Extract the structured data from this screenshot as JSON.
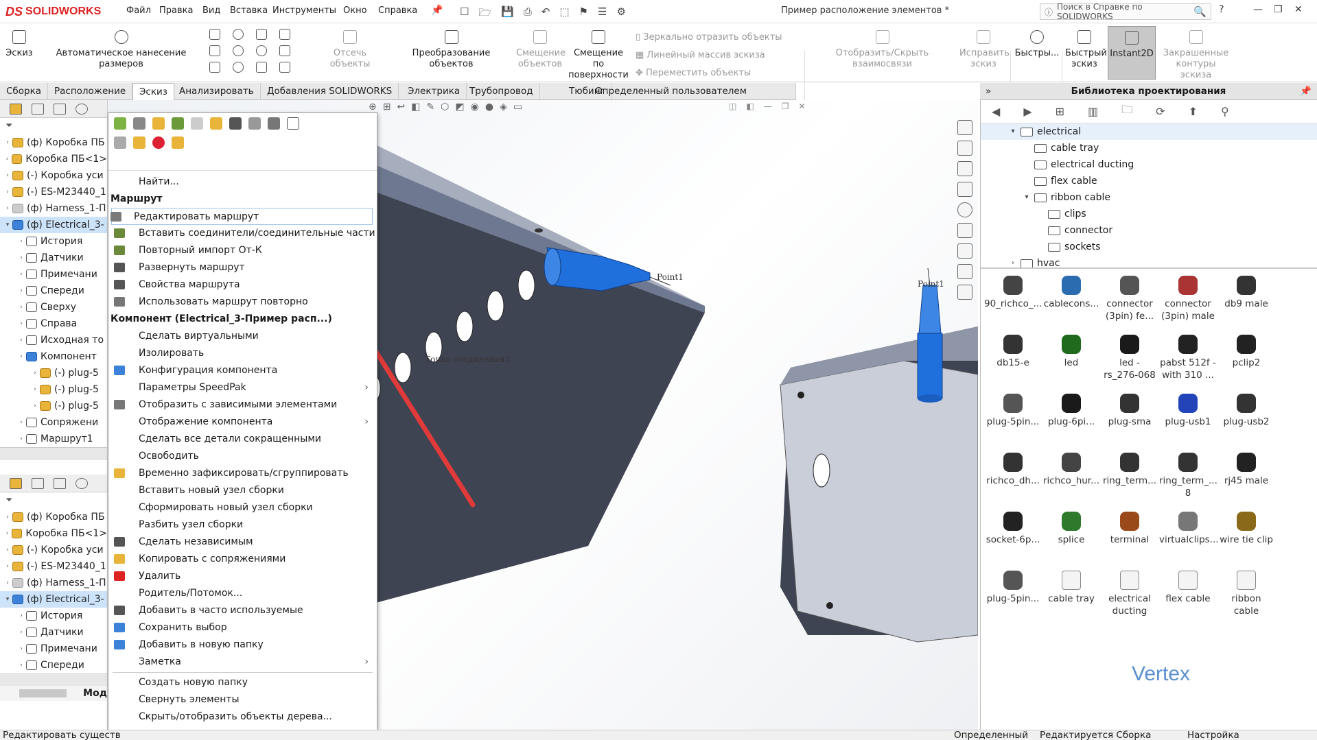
{
  "app": {
    "logo_text": "SOLIDWORKS",
    "logo_mark": "DS",
    "accent": "#d22020"
  },
  "menu": [
    "Файл",
    "Правка",
    "Вид",
    "Вставка",
    "Инструменты",
    "Окно",
    "Справка"
  ],
  "title": "Пример расположение элементов *",
  "help_search": {
    "placeholder": "Поиск в Справке по SOLIDWORKS"
  },
  "ribbon": {
    "sketch": "Эскиз",
    "auto_dim": "Автоматическое нанесение размеров",
    "trim": "Отсечь объекты",
    "convert": "Преобразование объектов",
    "offset1": "Смещение",
    "offset2": "объектов",
    "offset_surf1": "Смещение по",
    "offset_surf2": "поверхности",
    "mirror": "Зеркально отразить объекты",
    "linear": "Линейный массив эскиза",
    "move": "Переместить объекты",
    "show_hide": "Отобразить/Скрыть взаимосвязи",
    "fix1": "Исправить",
    "fix2": "эскиз",
    "quick1": "Быстры...",
    "qsketch1": "Быстрый",
    "qsketch2": "эскиз",
    "instant2d": "Instant2D",
    "shaded1": "Закрашенные",
    "shaded2": "контуры эскиза"
  },
  "tabs": [
    "Сборка",
    "Расположение",
    "Эскиз",
    "Анализировать",
    "Добавления SOLIDWORKS",
    "Электрика",
    "Трубопровод",
    "Тюбинг",
    "Определенный пользователем маршрут"
  ],
  "tree_top": [
    {
      "label": "(ф) Коробка ПБ",
      "type": "asm"
    },
    {
      "label": "Коробка ПБ<1>",
      "type": "asm"
    },
    {
      "label": "(-) Коробка уси",
      "type": "asm"
    },
    {
      "label": "(-) ES-M23440_1",
      "type": "asm"
    },
    {
      "label": "(ф) Harness_1-П",
      "type": "grey"
    },
    {
      "label": "(ф) Electrical_3-",
      "type": "blue",
      "sel": true
    },
    {
      "label": "История",
      "type": "folder",
      "indent": 1
    },
    {
      "label": "Датчики",
      "type": "folder",
      "indent": 1
    },
    {
      "label": "Примечани",
      "type": "folder",
      "indent": 1
    },
    {
      "label": "Спереди",
      "type": "folder",
      "indent": 1
    },
    {
      "label": "Сверху",
      "type": "folder",
      "indent": 1
    },
    {
      "label": "Справа",
      "type": "folder",
      "indent": 1
    },
    {
      "label": "Исходная то",
      "type": "folder",
      "indent": 1
    },
    {
      "label": "Компонент",
      "type": "blue",
      "indent": 1
    },
    {
      "label": "(-) plug-5",
      "type": "asm",
      "indent": 2
    },
    {
      "label": "(-) plug-5",
      "type": "asm",
      "indent": 2
    },
    {
      "label": "(-) plug-5",
      "type": "asm",
      "indent": 2
    },
    {
      "label": "Сопряжени",
      "type": "folder",
      "indent": 1
    },
    {
      "label": "Маршрут1",
      "type": "folder",
      "indent": 1
    }
  ],
  "tree_bottom": [
    {
      "label": "(ф) Коробка ПБ",
      "type": "asm"
    },
    {
      "label": "Коробка ПБ<1>",
      "type": "asm"
    },
    {
      "label": "(-) Коробка уси",
      "type": "asm"
    },
    {
      "label": "(-) ES-M23440_1",
      "type": "asm"
    },
    {
      "label": "(ф) Harness_1-П",
      "type": "grey"
    },
    {
      "label": "(ф) Electrical_3-",
      "type": "blue",
      "sel": true
    },
    {
      "label": "История",
      "type": "folder",
      "indent": 1
    },
    {
      "label": "Датчики",
      "type": "folder",
      "indent": 1
    },
    {
      "label": "Примечани",
      "type": "folder",
      "indent": 1
    },
    {
      "label": "Спереди",
      "type": "folder",
      "indent": 1
    }
  ],
  "left_bottom_tab": "Мод",
  "context_menu": {
    "find": "Найти...",
    "route_header": "Маршрут",
    "route_items": [
      {
        "label": "Редактировать маршрут",
        "hl": true,
        "color": "#7a7a7a"
      },
      {
        "label": "Вставить соединители/соединительные части",
        "color": "#6a8a3a"
      },
      {
        "label": "Повторный импорт От-К",
        "color": "#6a8a3a"
      },
      {
        "label": "Развернуть маршрут",
        "color": "#555"
      },
      {
        "label": "Свойства маршрута",
        "color": "#555"
      },
      {
        "label": "Использовать маршрут повторно",
        "color": "#777"
      }
    ],
    "component_header": "Компонент (Electrical_3-Пример расп...)",
    "component_items": [
      {
        "label": "Сделать виртуальными"
      },
      {
        "label": "Изолировать"
      },
      {
        "label": "Конфигурация компонента",
        "color": "#3b82d8"
      },
      {
        "label": "Параметры SpeedPak",
        "sub": true
      },
      {
        "label": "Отобразить с зависимыми элементами",
        "color": "#777"
      },
      {
        "label": "Отображение компонента",
        "sub": true
      },
      {
        "label": "Сделать все детали сокращенными"
      },
      {
        "label": "Освободить"
      },
      {
        "label": "Временно зафиксировать/сгруппировать",
        "color": "#e8b43a"
      },
      {
        "label": "Вставить новый узел сборки"
      },
      {
        "label": "Сформировать новый узел сборки"
      },
      {
        "label": "Разбить узел сборки"
      },
      {
        "label": "Сделать независимым",
        "color": "#555"
      },
      {
        "label": "Копировать с сопряжениями",
        "color": "#e8b43a"
      },
      {
        "label": "Удалить",
        "color": "#d22"
      },
      {
        "label": "Родитель/Потомок..."
      },
      {
        "label": "Добавить в часто используемые",
        "color": "#555"
      },
      {
        "label": "Сохранить выбор",
        "color": "#3b82d8"
      },
      {
        "label": "Добавить в новую папку",
        "color": "#3b82d8"
      },
      {
        "label": "Заметка",
        "sub": true
      }
    ],
    "bottom_items": [
      {
        "label": "Создать новую папку"
      },
      {
        "label": "Свернуть элементы"
      },
      {
        "label": "Скрыть/отобразить объекты дерева..."
      }
    ],
    "more": "»"
  },
  "viewport": {
    "point1": "Point1",
    "point1b": "Point1",
    "conn_point": "Точка соединения3",
    "arrow_color": "#e03a3a",
    "part_color": "#1f6fdc"
  },
  "library": {
    "header": "Библиотека проектирования",
    "tree": [
      {
        "label": "electrical",
        "level": 0,
        "expanded": true,
        "selected": true
      },
      {
        "label": "cable tray",
        "level": 1
      },
      {
        "label": "electrical ducting",
        "level": 1
      },
      {
        "label": "flex cable",
        "level": 1
      },
      {
        "label": "ribbon cable",
        "level": 1,
        "expanded": true
      },
      {
        "label": "clips",
        "level": 2
      },
      {
        "label": "connector",
        "level": 2
      },
      {
        "label": "sockets",
        "level": 2
      },
      {
        "label": "hvac",
        "level": 0
      }
    ],
    "items": [
      {
        "l1": "90_richco_...",
        "l2": "",
        "c": "#444"
      },
      {
        "l1": "cablecons...",
        "l2": "",
        "c": "#2b6cb0"
      },
      {
        "l1": "connector",
        "l2": "(3pin) fe...",
        "c": "#555"
      },
      {
        "l1": "connector",
        "l2": "(3pin) male",
        "c": "#a33"
      },
      {
        "l1": "db9 male",
        "l2": "",
        "c": "#333"
      },
      {
        "l1": "db15-e",
        "l2": "",
        "c": "#333"
      },
      {
        "l1": "led",
        "l2": "",
        "c": "#1e6b1e"
      },
      {
        "l1": "led -",
        "l2": "rs_276-068",
        "c": "#1a1a1a"
      },
      {
        "l1": "pabst 512f -",
        "l2": "with 310 ...",
        "c": "#222"
      },
      {
        "l1": "pclip2",
        "l2": "",
        "c": "#222"
      },
      {
        "l1": "plug-5pin...",
        "l2": "",
        "c": "#555"
      },
      {
        "l1": "plug-6pi...",
        "l2": "",
        "c": "#1a1a1a"
      },
      {
        "l1": "plug-sma",
        "l2": "",
        "c": "#333"
      },
      {
        "l1": "plug-usb1",
        "l2": "",
        "c": "#2344b8"
      },
      {
        "l1": "plug-usb2",
        "l2": "",
        "c": "#333"
      },
      {
        "l1": "richco_dh...",
        "l2": "",
        "c": "#333"
      },
      {
        "l1": "richco_hur...",
        "l2": "",
        "c": "#444"
      },
      {
        "l1": "ring_term...",
        "l2": "",
        "c": "#333"
      },
      {
        "l1": "ring_term_...",
        "l2": "8",
        "c": "#333"
      },
      {
        "l1": "rj45 male",
        "l2": "",
        "c": "#222"
      },
      {
        "l1": "socket-6p...",
        "l2": "",
        "c": "#222"
      },
      {
        "l1": "splice",
        "l2": "",
        "c": "#2d7a2d"
      },
      {
        "l1": "terminal",
        "l2": "",
        "c": "#9a4a1a"
      },
      {
        "l1": "virtualclips...",
        "l2": "",
        "c": "#777"
      },
      {
        "l1": "wire tie clip",
        "l2": "",
        "c": "#8a6a1a"
      },
      {
        "l1": "plug-5pin...",
        "l2": "",
        "c": "#555"
      },
      {
        "l1": "cable tray",
        "l2": "",
        "c": "folder"
      },
      {
        "l1": "electrical",
        "l2": "ducting",
        "c": "folder"
      },
      {
        "l1": "flex cable",
        "l2": "",
        "c": "folder"
      },
      {
        "l1": "ribbon",
        "l2": "cable",
        "c": "folder"
      }
    ],
    "watermark": "Vertex"
  },
  "status": {
    "left": "Редактировать существ",
    "s1": "Определенный",
    "s2": "Редактируется Сборка",
    "s3": "Настройка"
  }
}
